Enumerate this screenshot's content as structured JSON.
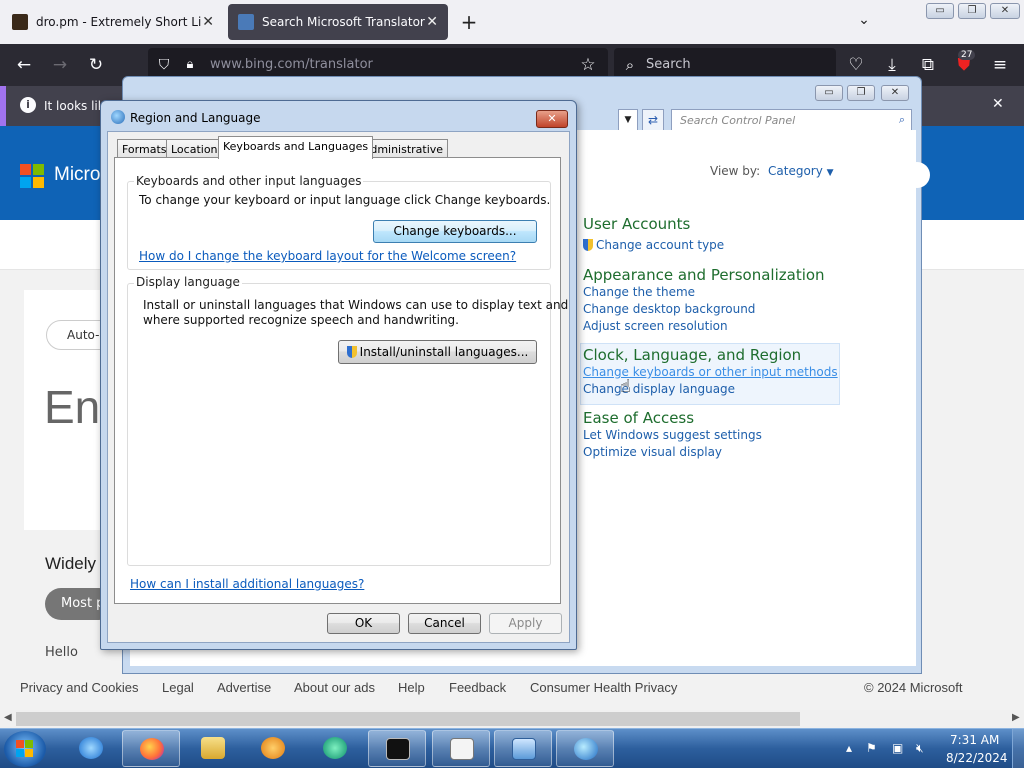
{
  "browser": {
    "tabs": [
      {
        "title": "dro.pm - Extremely Short Links",
        "close": "✕"
      },
      {
        "title": "Search Microsoft Translator",
        "close": "✕"
      }
    ],
    "new_tab": "+",
    "tab_list": "⌄",
    "url": "www.bing.com/translator",
    "search_placeholder": "Search",
    "extension_badge": "27",
    "infobar_text": "It looks like",
    "infobar_close": "✕"
  },
  "bing": {
    "brand": "Micro",
    "auto_detect": "Auto-d",
    "big_text": "En",
    "widely": "Widely",
    "most_pill": "Most p",
    "hello": "Hello",
    "footer": [
      "Privacy and Cookies",
      "Legal",
      "Advertise",
      "About our ads",
      "Help",
      "Feedback",
      "Consumer Health Privacy"
    ],
    "copyright": "© 2024 Microsoft"
  },
  "control_panel": {
    "search_placeholder": "Search Control Panel",
    "view_by_label": "View by:",
    "view_by_value": "Category",
    "categories": [
      {
        "title": "User Accounts",
        "links": [
          "Change account type"
        ]
      },
      {
        "title": "Appearance and Personalization",
        "links": [
          "Change the theme",
          "Change desktop background",
          "Adjust screen resolution"
        ]
      },
      {
        "title": "Clock, Language, and Region",
        "links": [
          "Change keyboards or other input methods",
          "Change display language"
        ]
      },
      {
        "title": "Ease of Access",
        "links": [
          "Let Windows suggest settings",
          "Optimize visual display"
        ]
      }
    ]
  },
  "dialog": {
    "title": "Region and Language",
    "close": "✕",
    "tabs": [
      "Formats",
      "Location",
      "Keyboards and Languages",
      "Administrative"
    ],
    "active_tab": "Keyboards and Languages",
    "kb_group_title": "Keyboards and other input languages",
    "kb_desc": "To change your keyboard or input language click Change keyboards.",
    "change_keyboards_btn": "Change keyboards...",
    "welcome_link": "How do I change the keyboard layout for the Welcome screen?",
    "display_group_title": "Display language",
    "display_desc_1": "Install or uninstall languages that Windows can use to display text and",
    "display_desc_2": "where supported recognize speech and handwriting.",
    "install_btn": "Install/uninstall languages...",
    "additional_link": "How can I install additional languages?",
    "ok": "OK",
    "cancel": "Cancel",
    "apply": "Apply"
  },
  "taskbar": {
    "apps": [
      "internet-explorer",
      "firefox",
      "file-explorer",
      "media-player",
      "browser-app",
      "command-prompt",
      "notepad",
      "control-panel",
      "region-globe"
    ],
    "time": "7:31 AM",
    "date": "8/22/2024"
  }
}
